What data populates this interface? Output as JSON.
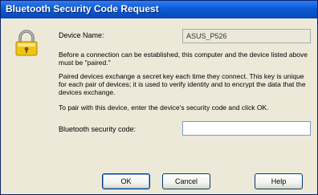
{
  "dialog": {
    "title": "Bluetooth Security Code Request"
  },
  "device": {
    "label": "Device Name:",
    "value": "ASUS_P526"
  },
  "paragraphs": {
    "p1": "Before a connection can be established, this computer and the device listed above must be \"paired.\"",
    "p2": "Paired devices exchange a secret key each time they connect. This key is unique for each pair of devices; it is used to verify identity and to encrypt the data that the devices exchange.",
    "p3": "To pair with this device, enter the device's security code and click OK."
  },
  "security_code": {
    "label": "Bluetooth security code:",
    "value": ""
  },
  "buttons": {
    "ok": "OK",
    "cancel": "Cancel",
    "help": "Help"
  },
  "icons": {
    "dialog_icon": "padlock-icon"
  },
  "colors": {
    "titlebar": "#0b5bd6",
    "dialog_background": "#ece9d8"
  }
}
